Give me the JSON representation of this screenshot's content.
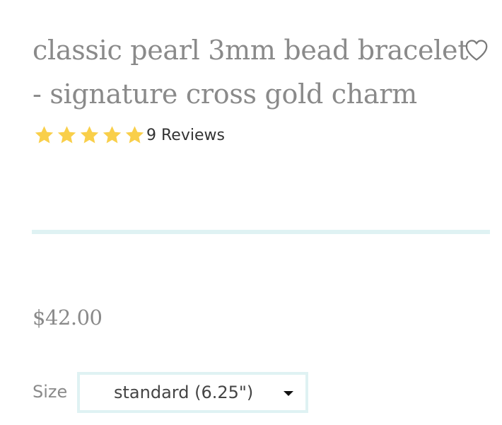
{
  "product": {
    "title_line1": "classic pearl 3mm bead bracelet",
    "title_line2": "- signature cross gold charm",
    "price": "$42.00"
  },
  "wishlist": {
    "icon": "heart-outline-icon"
  },
  "rating": {
    "stars": 5,
    "max_stars": 5,
    "reviews_label": "9 Reviews",
    "star_color": "#f9cf4a"
  },
  "options": {
    "size_label": "Size",
    "size_selected": "standard (6.25\")"
  },
  "colors": {
    "title_text": "#8a8a8a",
    "accent_border": "#dff2f3"
  }
}
